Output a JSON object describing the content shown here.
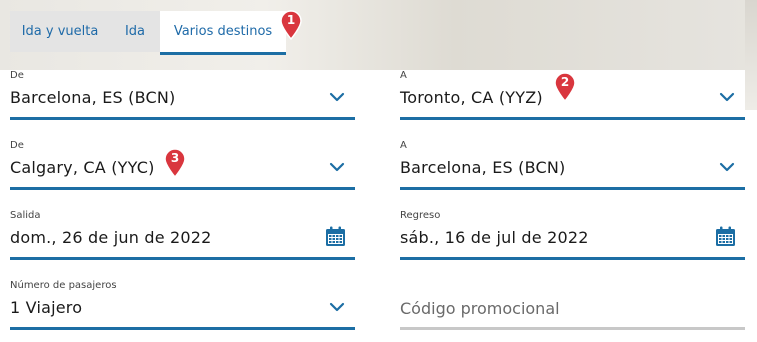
{
  "tabs": [
    {
      "label": "Ida y vuelta"
    },
    {
      "label": "Ida"
    },
    {
      "label": "Varios destinos"
    }
  ],
  "markers": [
    "1",
    "2",
    "3"
  ],
  "segment1": {
    "from_label": "De",
    "from_value": "Barcelona, ES (BCN)",
    "to_label": "A",
    "to_value": "Toronto, CA (YYZ)"
  },
  "segment2": {
    "from_label": "De",
    "from_value": "Calgary, CA (YYC)",
    "to_label": "A",
    "to_value": "Barcelona, ES (BCN)"
  },
  "dates": {
    "departure_label": "Salida",
    "departure_value": "dom., 26 de jun de 2022",
    "return_label": "Regreso",
    "return_value": "sáb., 16 de jul de 2022"
  },
  "passengers": {
    "label": "Número de pasajeros",
    "value": "1 Viajero"
  },
  "promo": {
    "placeholder": "Código promocional"
  },
  "colors": {
    "accent": "#1c6ea4",
    "link": "#1e6aa8",
    "marker": "#d9363e",
    "tab_bg": "#e4e4e4"
  },
  "icons": {
    "dropdown": "chevron-down-icon",
    "calendar": "calendar-icon",
    "marker": "map-pin-icon"
  }
}
